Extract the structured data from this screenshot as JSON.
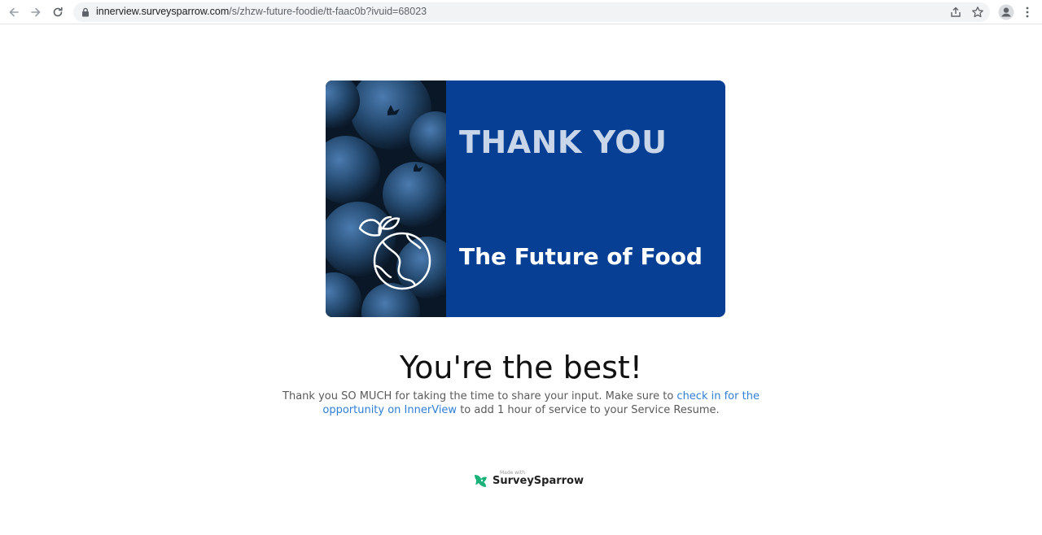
{
  "browser": {
    "url_host": "innerview.surveysparrow.com",
    "url_path": "/s/zhzw-future-foodie/tt-faac0b?ivuid=68023",
    "icons": [
      "back-icon",
      "forward-icon",
      "reload-icon",
      "lock-icon",
      "share-icon",
      "bookmark-star-icon",
      "profile-icon",
      "menu-icon"
    ]
  },
  "banner": {
    "title": "THANK YOU",
    "subtitle": "The Future of Food",
    "colors": {
      "panel": "#063f93",
      "title": "#c9d6ea"
    }
  },
  "heading": "You're the best!",
  "message": {
    "before": "Thank you SO MUCH for taking the time to share your input. Make sure to ",
    "link": "check in for the opportunity on InnerView",
    "after": " to add 1 hour of service to your Service Resume."
  },
  "footer": {
    "made_with": "Made with",
    "brand": "SurveySparrow",
    "accent": "#1bb27a"
  }
}
